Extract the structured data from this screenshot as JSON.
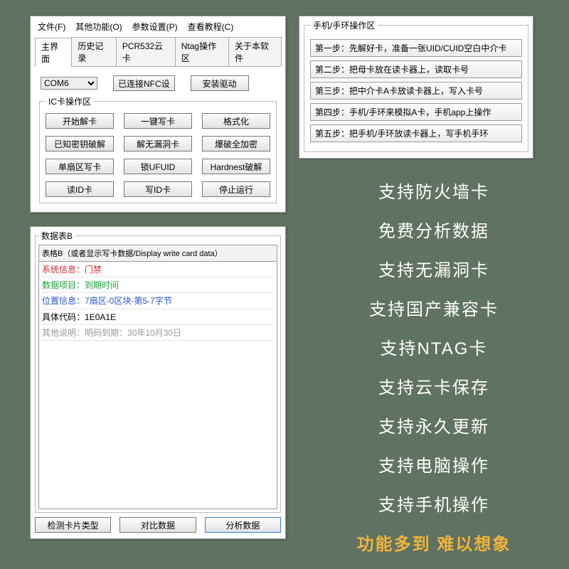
{
  "menubar": {
    "file": "文件(F)",
    "other": "其他功能(O)",
    "param": "参数设置(P)",
    "help": "查看教程(C)"
  },
  "tabs": {
    "main": "主界面",
    "history": "历史记录",
    "cloud": "PCR532云卡",
    "ntag": "Ntag操作区",
    "about": "关于本软件"
  },
  "port": {
    "selected": "COM6"
  },
  "status_nfc": "已连接NFC设",
  "install_driver": "安装驱动",
  "ic_group": "IC卡操作区",
  "ic": {
    "b0": "开始解卡",
    "b1": "一键写卡",
    "b2": "格式化",
    "b3": "已知密钥破解",
    "b4": "解无漏洞卡",
    "b5": "爆破全加密",
    "b6": "单扇区写卡",
    "b7": "锁UFUID",
    "b8": "Hardnest破解",
    "b9": "读ID卡",
    "b10": "写ID卡",
    "b11": "停止运行"
  },
  "phone": {
    "legend": "手机/手环操作区",
    "s1": "第一步：先解好卡，准备一张UID/CUID空白中介卡",
    "s2": "第二步：把母卡放在读卡器上，读取卡号",
    "s3": "第三步：把中介卡A卡放读卡器上，写入卡号",
    "s4": "第四步：手机/手环来模拟A卡，手机app上操作",
    "s5": "第五步：把手机/手环放读卡器上，写手机手环"
  },
  "datab": {
    "legend": "数据表B",
    "header": "表格B（或者显示写卡数据/Display write card data）",
    "rows": {
      "sys": {
        "label": "系统信息：",
        "value": "门禁",
        "color": "#c83232"
      },
      "proj": {
        "label": "数据项目：",
        "value": "到期时间",
        "color": "#1fa33a"
      },
      "pos": {
        "label": "位置信息：",
        "value": "7扇区-0区块-第5-7字节",
        "color": "#2756c8"
      },
      "code": {
        "label": "具体代码：",
        "value": "1E0A1E",
        "color": "#000000"
      },
      "other": {
        "label": "其他说明：",
        "value": "明码到期：30年10月30日",
        "color": "#9a9a9a"
      }
    },
    "btn_detect": "检测卡片类型",
    "btn_compare": "对比数据",
    "btn_analyze": "分析数据"
  },
  "features": {
    "f0": "支持防火墙卡",
    "f1": "免费分析数据",
    "f2": "支持无漏洞卡",
    "f3": "支持国产兼容卡",
    "f4": "支持NTAG卡",
    "f5": "支持云卡保存",
    "f6": "支持永久更新",
    "f7": "支持电脑操作",
    "f8": "支持手机操作",
    "f9": "功能多到 难以想象"
  }
}
